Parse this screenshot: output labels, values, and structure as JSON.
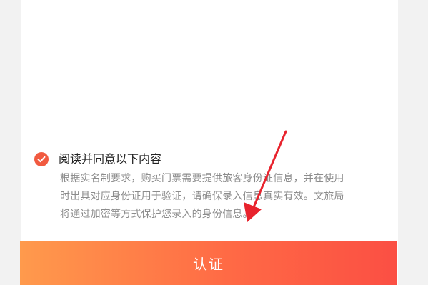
{
  "consent": {
    "checked": true,
    "title": "阅读并同意以下内容",
    "body_lines": [
      "根据实名制要求，购买门票需要提供旅客身份证信息，并在使用",
      "时出具对应身份证用于验证，请确保录入信息真实有效。文旅局",
      "将通过加密等方式保护您录入的身份信息。"
    ]
  },
  "verify_button": {
    "label": "认证"
  },
  "colors": {
    "accent": "#f15a40",
    "button_gradient_start": "#ff9a4c",
    "button_gradient_end": "#fb4f44",
    "annotation_arrow": "#e8232d"
  },
  "icons": {
    "consent_check": "check-circle-icon",
    "annotation": "arrow-icon"
  }
}
